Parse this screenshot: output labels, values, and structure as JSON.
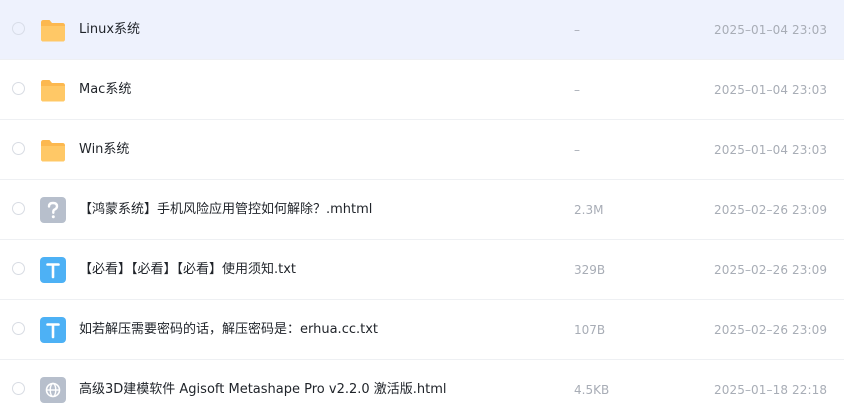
{
  "files": [
    {
      "name": "Linux系统",
      "size": "–",
      "date": "2025–01–04 23:03",
      "icon": "folder-icon"
    },
    {
      "name": "Mac系统",
      "size": "–",
      "date": "2025–01–04 23:03",
      "icon": "folder-icon"
    },
    {
      "name": "Win系统",
      "size": "–",
      "date": "2025–01–04 23:03",
      "icon": "folder-icon"
    },
    {
      "name": "【鸿蒙系统】手机风险应用管控如何解除？.mhtml",
      "size": "2.3M",
      "date": "2025–02–26 23:09",
      "icon": "unknown-file-icon"
    },
    {
      "name": "【必看】【必看】【必看】使用须知.txt",
      "size": "329B",
      "date": "2025–02–26 23:09",
      "icon": "text-file-icon"
    },
    {
      "name": "如若解压需要密码的话，解压密码是：erhua.cc.txt",
      "size": "107B",
      "date": "2025–02–26 23:09",
      "icon": "text-file-icon"
    },
    {
      "name": "高级3D建模软件 Agisoft Metashape Pro v2.2.0 激活版.html",
      "size": "4.5KB",
      "date": "2025–01–18 22:18",
      "icon": "web-file-icon"
    }
  ],
  "colors": {
    "hover_row": "#eef2fd",
    "folder": "#fcb84f",
    "text_file": "#4db1f5",
    "unknown_file": "#b7bfcc",
    "web_file": "#b7bfcc"
  }
}
